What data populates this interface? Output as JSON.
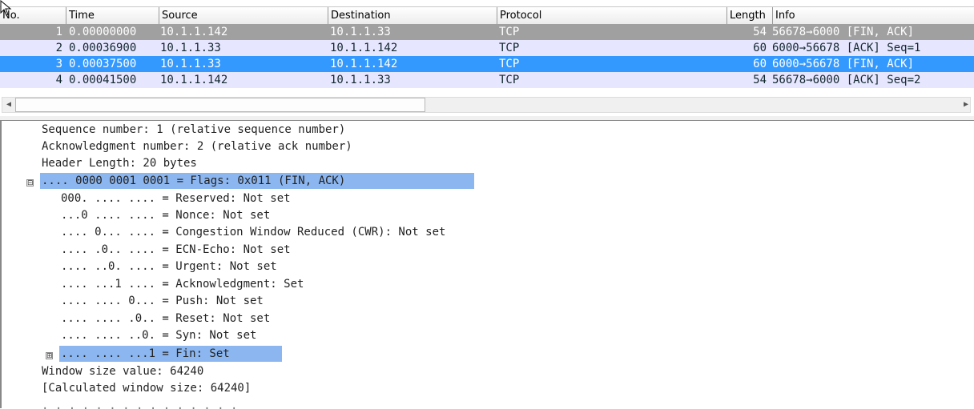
{
  "columns": [
    "No.",
    "Time",
    "Source",
    "Destination",
    "Protocol",
    "Length",
    "Info"
  ],
  "packets": [
    {
      "no": "1",
      "time": "0.00000000",
      "src": "10.1.1.142",
      "dst": "10.1.1.33",
      "proto": "TCP",
      "len": "54",
      "info": "56678→6000 [FIN, ACK]"
    },
    {
      "no": "2",
      "time": "0.00036900",
      "src": "10.1.1.33",
      "dst": "10.1.1.142",
      "proto": "TCP",
      "len": "60",
      "info": "6000→56678 [ACK] Seq=1"
    },
    {
      "no": "3",
      "time": "0.00037500",
      "src": "10.1.1.33",
      "dst": "10.1.1.142",
      "proto": "TCP",
      "len": "60",
      "info": "6000→56678 [FIN, ACK]"
    },
    {
      "no": "4",
      "time": "0.00041500",
      "src": "10.1.1.142",
      "dst": "10.1.1.33",
      "proto": "TCP",
      "len": "54",
      "info": "56678→6000 [ACK] Seq=2"
    }
  ],
  "details": [
    "Sequence number: 1    (relative sequence number)",
    "Acknowledgment number: 2    (relative ack number)",
    "Header Length: 20 bytes",
    ".... 0000 0001 0001 = Flags: 0x011 (FIN, ACK)",
    "000. .... .... = Reserved: Not set",
    "...0 .... .... = Nonce: Not set",
    ".... 0... .... = Congestion Window Reduced (CWR): Not set",
    ".... .0.. .... = ECN-Echo: Not set",
    ".... ..0. .... = Urgent: Not set",
    ".... ...1 .... = Acknowledgment: Set",
    ".... .... 0... = Push: Not set",
    ".... .... .0.. = Reset: Not set",
    ".... .... ..0. = Syn: Not set",
    ".... .... ...1 = Fin: Set",
    "Window size value: 64240",
    "[Calculated window size: 64240]"
  ],
  "tree_toggles": {
    "flags": "⊟",
    "fin": "⊞"
  },
  "colors": {
    "selected_row": "#3399ff",
    "tcp_row": "#e7e6ff",
    "marked_row": "#a0a0a0",
    "detail_selected": "#8cb6ef"
  },
  "icons": {
    "scroll_left": "◀",
    "scroll_right": "▶",
    "cursor": "arrow-cursor"
  }
}
